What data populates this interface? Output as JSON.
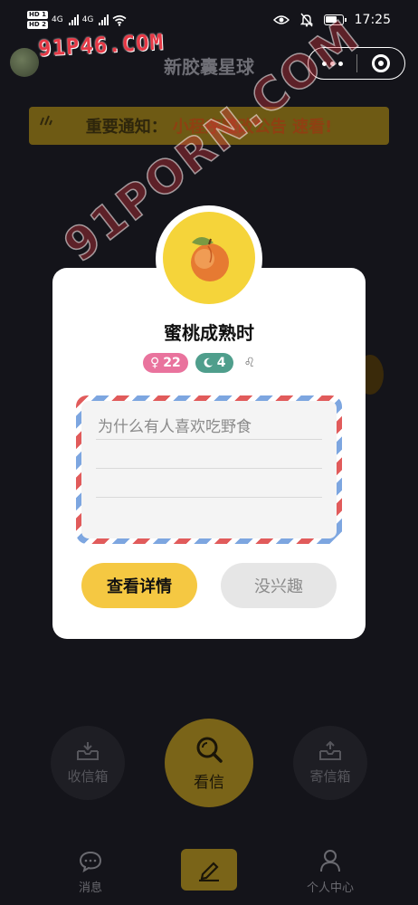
{
  "status_bar": {
    "hd1": "HD 1",
    "hd2": "HD 2",
    "net1": "4G",
    "net2": "4G",
    "time": "17:25",
    "battery_level": 0.7
  },
  "header": {
    "title": "新胶囊星球",
    "watermark": "91P46.COM"
  },
  "notice": {
    "label": "重要通知：",
    "text": "小程序整改公告 速看!"
  },
  "watermark_diagonal": "91PORN.COM",
  "card": {
    "title": "蜜桃成熟时",
    "gender_symbol": "♀",
    "age": "22",
    "moon_count": "4",
    "zodiac": "♌",
    "letter_text": "为什么有人喜欢吃野食",
    "detail_button": "查看详情",
    "skip_button": "没兴趣"
  },
  "actions": {
    "inbox": "收信箱",
    "look": "看信",
    "outbox": "寄信箱"
  },
  "tabbar": {
    "messages": "消息",
    "profile": "个人中心"
  },
  "colors": {
    "background": "#14141a",
    "accent_yellow": "#f5c842",
    "gender_pink": "#e9739d",
    "moon_teal": "#4f9e8c"
  }
}
